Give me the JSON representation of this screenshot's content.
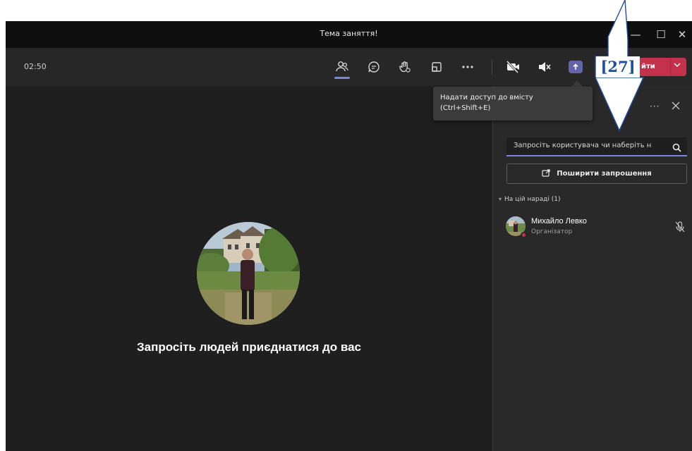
{
  "window": {
    "title": "Тема заняття!",
    "minimize": "—",
    "maximize": "☐",
    "close": "✕"
  },
  "toolbar": {
    "timer": "02:50",
    "buttons": [
      "people-icon",
      "chat-icon",
      "raise-hand-icon",
      "rooms-icon",
      "more-icon",
      "camera-off-icon",
      "speaker-muted-icon",
      "share-content-icon"
    ],
    "leave_label": "йти",
    "leave_color": "#c4314b",
    "accent": "#6264a7"
  },
  "tooltip": {
    "line1": "Надати доступ до вмісту",
    "line2": "(Ctrl+Shift+E)"
  },
  "stage": {
    "invite_text": "Запросіть людей приєднатися до вас"
  },
  "panel": {
    "more": "···",
    "search_placeholder": "Запросіть користувача чи наберіть н",
    "share_invite_label": "Поширити запрошення",
    "section_title": "На цій нараді (1)",
    "participants": [
      {
        "name": "Михайло Левко",
        "role": "Організатор",
        "status_color": "#c4314b"
      }
    ]
  },
  "annotation": {
    "label": "[27]",
    "arrow_color": "#1f4e9a"
  }
}
